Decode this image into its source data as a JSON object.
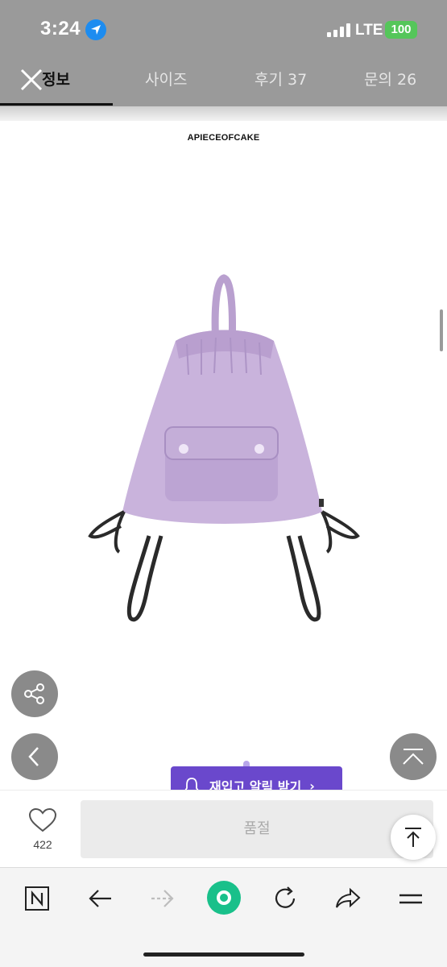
{
  "status_bar": {
    "time": "3:24",
    "network": "LTE",
    "battery": "100"
  },
  "tabs": [
    {
      "label": "정보",
      "active": true
    },
    {
      "label": "사이즈",
      "active": false
    },
    {
      "label": "후기 37",
      "active": false
    },
    {
      "label": "문의 26",
      "active": false
    }
  ],
  "product": {
    "brand": "APIECEOFCAKE",
    "image_description_icon": "lavender-drawstring-backpack"
  },
  "floating": {
    "share_icon": "share-icon",
    "prev_icon": "chevron-left-icon",
    "top_icon": "scroll-top-icon"
  },
  "restock": {
    "label": "재입고 알림 받기",
    "chevron": "›"
  },
  "action_bar": {
    "like_count": "422",
    "soldout_label": "품절"
  },
  "toolbar": {
    "items": [
      "naver-n-icon",
      "back-arrow-icon",
      "forward-arrow-icon",
      "green-home-icon",
      "refresh-icon",
      "share-arrow-icon",
      "menu-icon"
    ]
  },
  "colors": {
    "accent": "#6a48cc",
    "status_green": "#55c65a",
    "product_lavender": "#c9b3dc"
  }
}
